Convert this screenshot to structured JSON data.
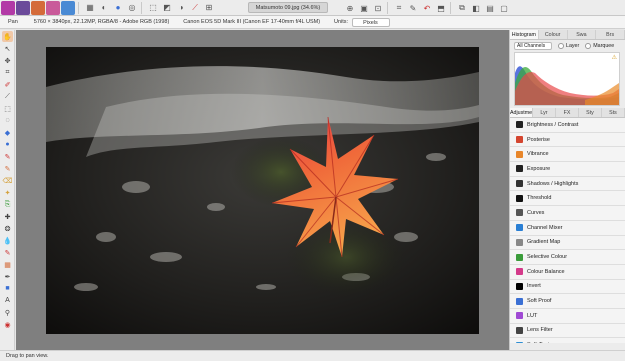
{
  "toolbar": {
    "document_tab": "Matsumoto 09.jpg (34.6%)"
  },
  "context": {
    "tool_name": "Pan",
    "image_info": "5760 × 3840px, 22.12MP, RGBA/8 - Adobe RGB (1998)",
    "camera_info": "Canon EOS 5D Mark III (Canon EF 17-40mm f/4L USM)",
    "units_label": "Units:",
    "units_value": "Pixels"
  },
  "panel": {
    "top_tabs": [
      "Histogram",
      "Colour",
      "Swa",
      "Brs"
    ],
    "channels_select": "All Channels",
    "layer_label": "Layer",
    "marquee_label": "Marquee",
    "bottom_tabs": [
      "Adjustment",
      "Lyr",
      "FX",
      "Sty",
      "Sts"
    ],
    "adjustments": [
      {
        "label": "Brightness / Contrast",
        "icon": "brightness-contrast-icon",
        "color": "#222222"
      },
      {
        "label": "Posterise",
        "icon": "posterise-icon",
        "color": "#d4452f"
      },
      {
        "label": "Vibrance",
        "icon": "vibrance-icon",
        "color": "#e8862a"
      },
      {
        "label": "Exposure",
        "icon": "exposure-icon",
        "color": "#222222"
      },
      {
        "label": "Shadows / Highlights",
        "icon": "shadows-highlights-icon",
        "color": "#333333"
      },
      {
        "label": "Threshold",
        "icon": "threshold-icon",
        "color": "#111111"
      },
      {
        "label": "Curves",
        "icon": "curves-icon",
        "color": "#555555"
      },
      {
        "label": "Channel Mixer",
        "icon": "channel-mixer-icon",
        "color": "#2a7fd4"
      },
      {
        "label": "Gradient Map",
        "icon": "gradient-map-icon",
        "color": "#888888"
      },
      {
        "label": "Selective Colour",
        "icon": "selective-colour-icon",
        "color": "#3a9c3a"
      },
      {
        "label": "Colour Balance",
        "icon": "colour-balance-icon",
        "color": "#d43a8a"
      },
      {
        "label": "Invert",
        "icon": "invert-icon",
        "color": "#000000"
      },
      {
        "label": "Soft Proof",
        "icon": "soft-proof-icon",
        "color": "#3a6fd4"
      },
      {
        "label": "LUT",
        "icon": "lut-icon",
        "color": "#a04ad4"
      },
      {
        "label": "Lens Filter",
        "icon": "lens-filter-icon",
        "color": "#444444"
      },
      {
        "label": "Split Toning",
        "icon": "split-toning-icon",
        "color": "#2f8fd4"
      }
    ]
  },
  "status": {
    "text": "Drag to pan view."
  }
}
